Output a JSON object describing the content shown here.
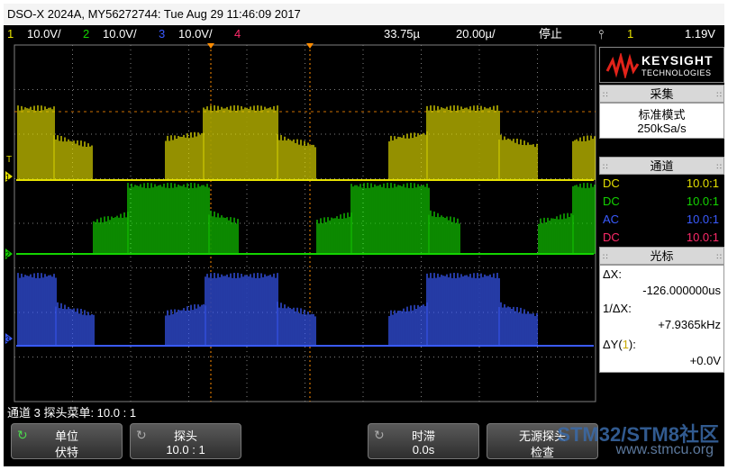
{
  "title": "DSO-X 2024A, MY56272744: Tue Aug 29 11:46:09 2017",
  "status": {
    "ch1_num": "1",
    "ch1_scale": "10.0V/",
    "ch2_num": "2",
    "ch2_scale": "10.0V/",
    "ch3_num": "3",
    "ch3_scale": "10.0V/",
    "ch4_num": "4",
    "delay": "33.75µ",
    "timebase": "20.00µ/",
    "run_state": "停止",
    "trigger_icon": "trigger-edge-icon",
    "trig_channel": "1",
    "trig_level": "1.19V"
  },
  "colors": {
    "ch1": "#e5e000",
    "ch2": "#14d400",
    "ch3": "#3a5bff",
    "ch4": "#ff2a6a",
    "grid": "#808080",
    "marker": "#ff8c00"
  },
  "logo": {
    "brand": "KEYSIGHT",
    "sub": "TECHNOLOGIES"
  },
  "acquire": {
    "title": "采集",
    "mode": "标准模式",
    "rate": "250kSa/s"
  },
  "channels": {
    "title": "通道",
    "rows": [
      {
        "coupling": "DC",
        "probe": "10.0:1"
      },
      {
        "coupling": "DC",
        "probe": "10.0:1"
      },
      {
        "coupling": "AC",
        "probe": "10.0:1"
      },
      {
        "coupling": "DC",
        "probe": "10.0:1"
      }
    ]
  },
  "cursor": {
    "title": "光标",
    "dx_label": "ΔX:",
    "dx_value": "-126.000000us",
    "inv_dx_label": "1/ΔX:",
    "inv_dx_value": "+7.9365kHz",
    "dy_label": "ΔY(",
    "dy_ch": "1",
    "dy_suffix": "):",
    "dy_value": "+0.0V"
  },
  "screen_labels": {
    "trig_t": "T",
    "m1": "1",
    "m2": "2",
    "m3": "3"
  },
  "message": "通道 3 探头菜单: 10.0 : 1",
  "softkeys": [
    {
      "line1": "单位",
      "line2": "伏特"
    },
    {
      "line1": "探头",
      "line2": "10.0 : 1"
    },
    {
      "line1": "时滞",
      "line2": "0.0s"
    },
    {
      "line1": "无源探头",
      "line2": "检查"
    }
  ],
  "watermark": {
    "main": "STM32/STM8社区",
    "url": "www.stmcu.org"
  }
}
